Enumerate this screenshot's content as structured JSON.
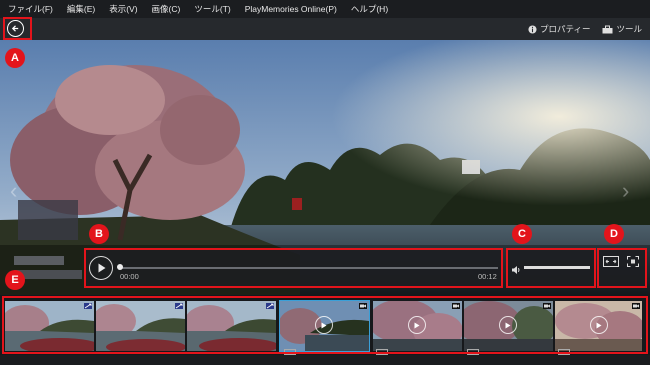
{
  "menu": [
    "ファイル(F)",
    "編集(E)",
    "表示(V)",
    "画像(C)",
    "ツール(T)",
    "PlayMemories Online(P)",
    "ヘルプ(H)"
  ],
  "toolbar": {
    "properties_label": "プロパティー",
    "tools_label": "ツール"
  },
  "player": {
    "current_time": "00:00",
    "end_time": "00:12",
    "progress": 0.0,
    "volume": 1.0
  },
  "callouts": {
    "a": "A",
    "b": "B",
    "c": "C",
    "d": "D",
    "e": "E"
  },
  "filmstrip": [
    {
      "kind": "photo",
      "icon": "expand-icon"
    },
    {
      "kind": "photo",
      "icon": "expand-icon"
    },
    {
      "kind": "photo",
      "icon": "expand-icon"
    },
    {
      "kind": "video",
      "icon": "video-camera-icon",
      "selected": true
    },
    {
      "kind": "video",
      "icon": "video-camera-icon"
    },
    {
      "kind": "video",
      "icon": "video-camera-icon"
    },
    {
      "kind": "video",
      "icon": "video-camera-icon"
    }
  ],
  "colors": {
    "accent_red": "#e3141b",
    "selection_blue": "#3aa0d8",
    "menubar_bg": "#1b1d20"
  }
}
